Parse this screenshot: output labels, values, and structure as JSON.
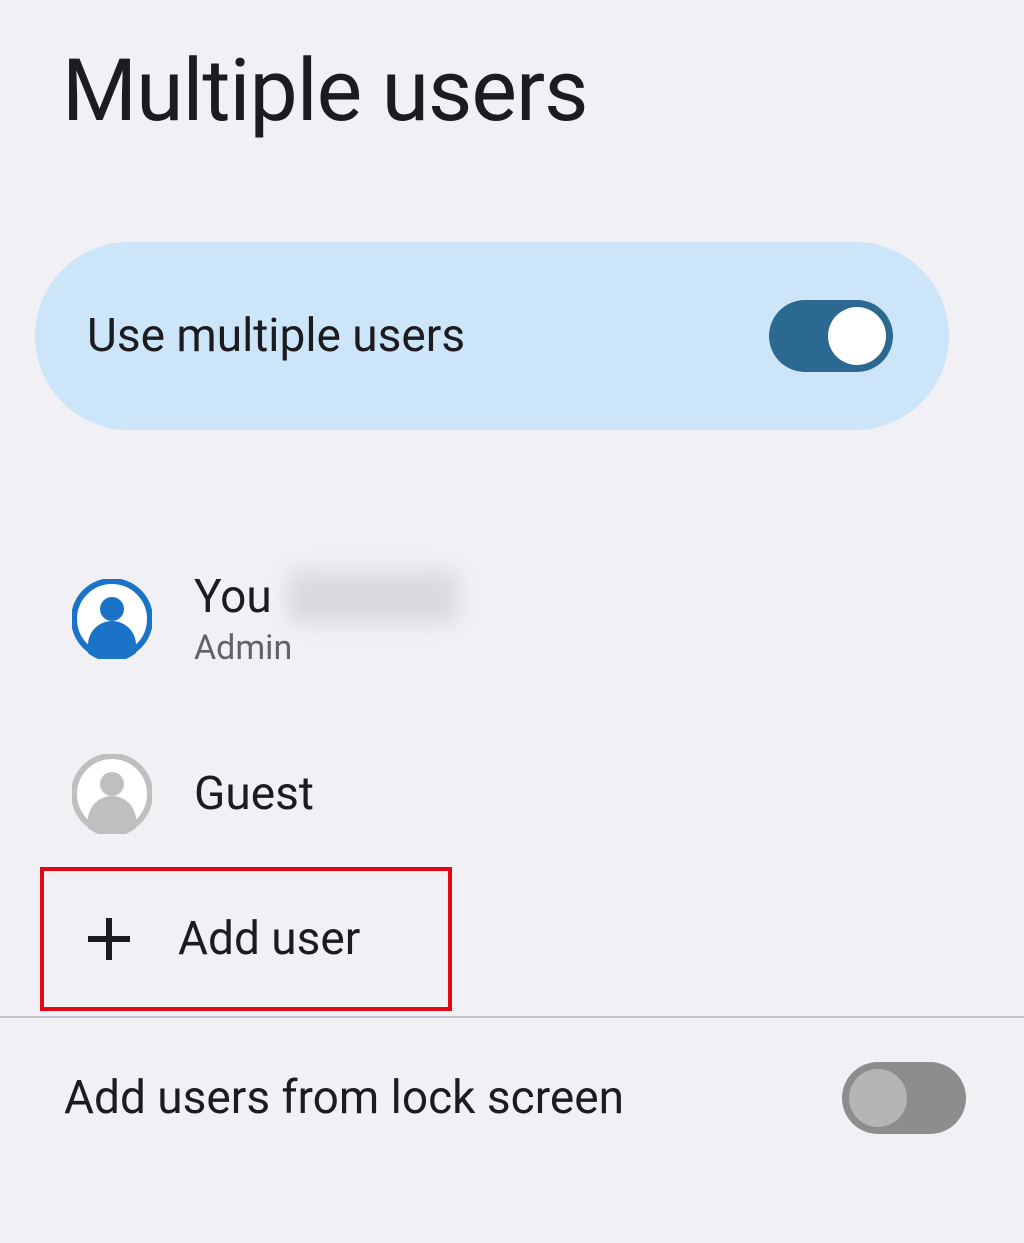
{
  "page": {
    "title": "Multiple users"
  },
  "toggleCard": {
    "label": "Use multiple users",
    "enabled": true
  },
  "users": [
    {
      "name": "You",
      "role": "Admin",
      "avatar_style": "primary",
      "name_blurred_suffix": true
    },
    {
      "name": "Guest",
      "role": "",
      "avatar_style": "grey",
      "name_blurred_suffix": false
    }
  ],
  "addUser": {
    "label": "Add user",
    "highlighted": true,
    "highlight_color": "#e30613"
  },
  "lockScreen": {
    "label": "Add users from lock screen",
    "enabled": false
  },
  "colors": {
    "background": "#f1f0f5",
    "card": "#cde5f9",
    "switch_on_track": "#2b6991",
    "switch_off_track": "#8d8d8d",
    "switch_off_thumb": "#b5b5b5",
    "avatar_primary": "#1a73c7",
    "avatar_grey": "#bfbfbf",
    "text_primary": "#1c1b1f",
    "text_secondary": "#5f6368"
  }
}
